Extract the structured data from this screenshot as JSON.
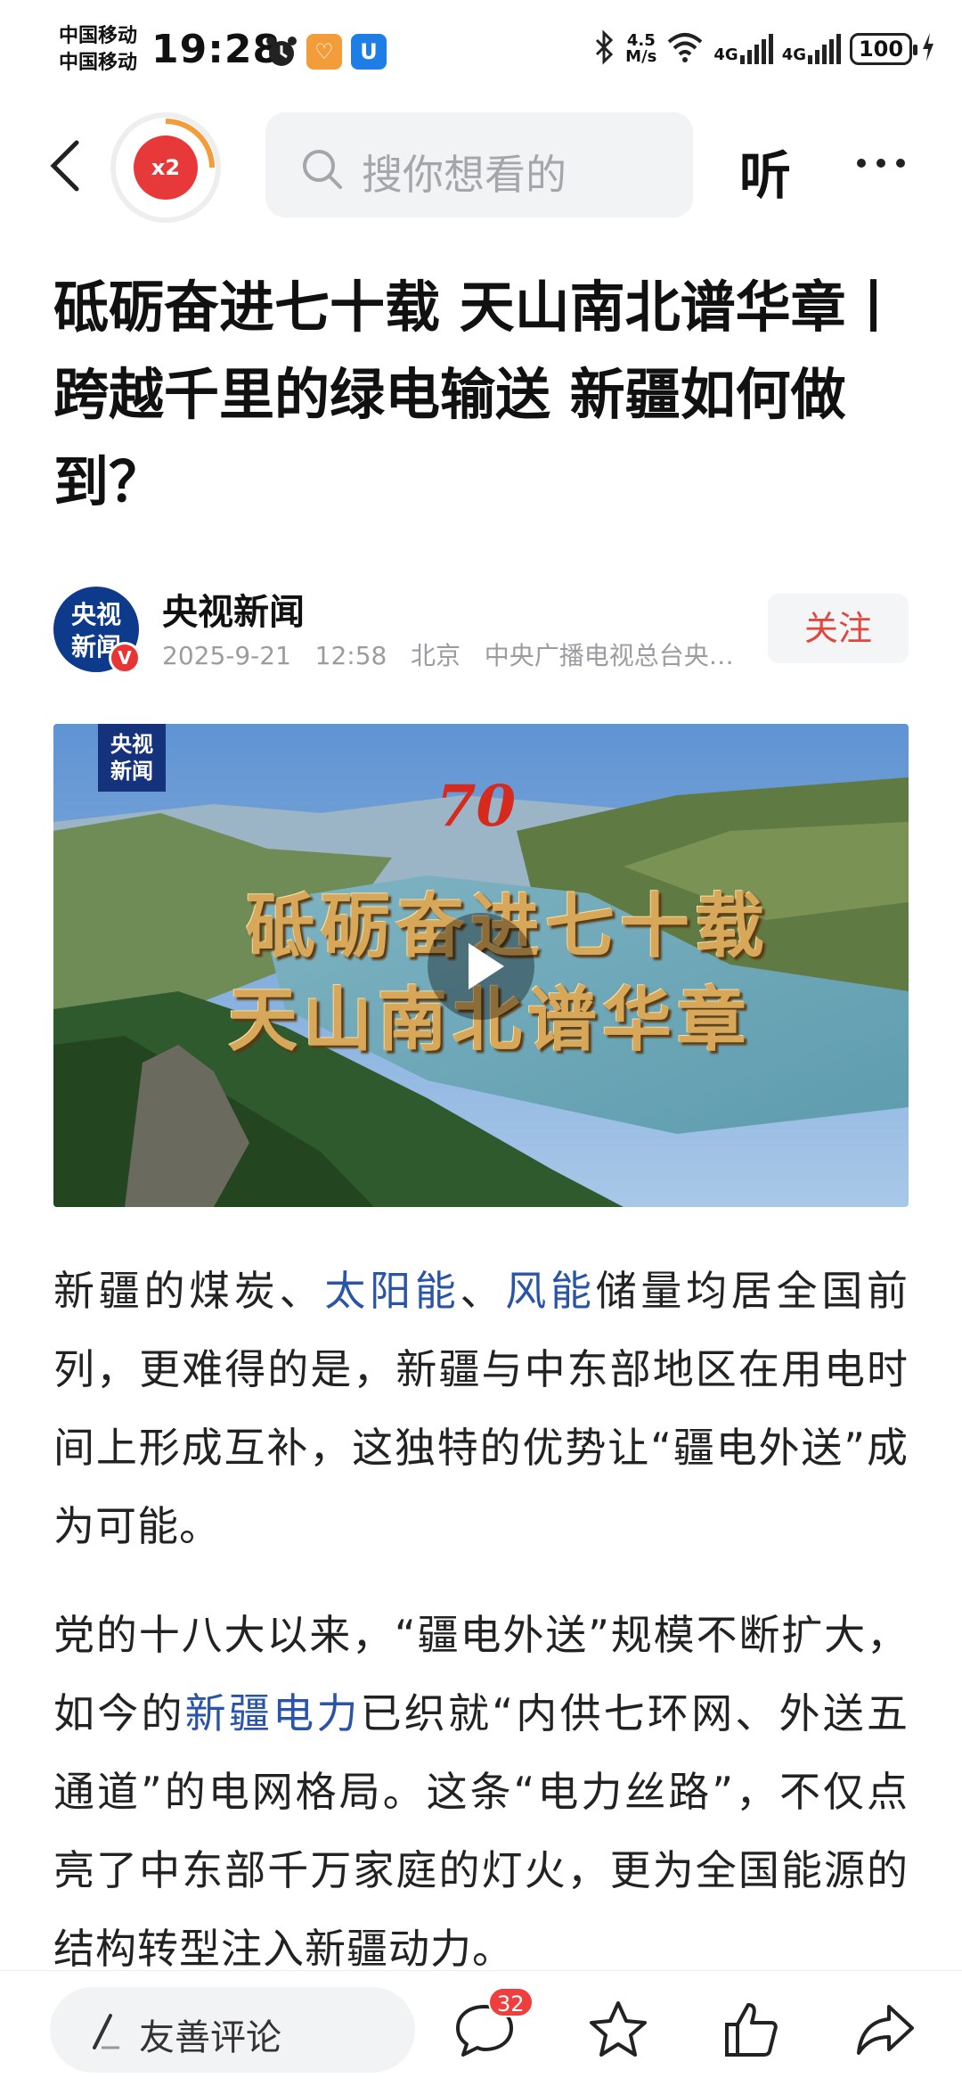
{
  "status_bar": {
    "carrier_1": "中国移动",
    "carrier_2": "中国移动",
    "time": "19:28",
    "net_speed_value": "4.5",
    "net_speed_unit": "M/s",
    "network_1": "4G",
    "network_2": "4G",
    "battery": "100"
  },
  "header": {
    "reward_label": "x2",
    "search_placeholder": "搜你想看的",
    "listen_label": "听"
  },
  "article": {
    "title": "砥砺奋进七十载 天山南北谱华章丨跨越千里的绿电输送 新疆如何做到？",
    "author": {
      "name": "央视新闻",
      "avatar_text_1": "央视",
      "avatar_text_2": "新闻",
      "verified": "V",
      "date": "2025-9-21",
      "time": "12:58",
      "location": "北京",
      "source": "中央广播电视总台央…",
      "follow_label": "关注"
    },
    "video": {
      "logo_1": "央视",
      "logo_2": "新闻",
      "anniversary": "70",
      "caption_1": "砥砺奋进七十载",
      "caption_2": "天山南北谱华章"
    },
    "p1": {
      "s1": "新疆的煤炭、",
      "l1": "太阳能",
      "s2": "、",
      "l2": "风能",
      "s3": "储量均居全国前列，更难得的是，新疆与中东部地区在用电时间上形成互补，这独特的优势让“疆电外送”成为可能。"
    },
    "p2": {
      "s1": "党的十八大以来，“疆电外送”规模不断扩大，如今的",
      "l1": "新疆电力",
      "s2": "已织就“内供七环网、外送五通道”的电网格局。这条“电力丝路”，不仅点亮了中东部千万家庭的灯火，更为全国能源的结构转型注入新疆动力。"
    }
  },
  "bottom_bar": {
    "comment_placeholder": "友善评论",
    "comment_count": "32"
  },
  "colors": {
    "link": "#2a54a8",
    "follow_text": "#e0473d",
    "badge": "#ef3e3e"
  }
}
